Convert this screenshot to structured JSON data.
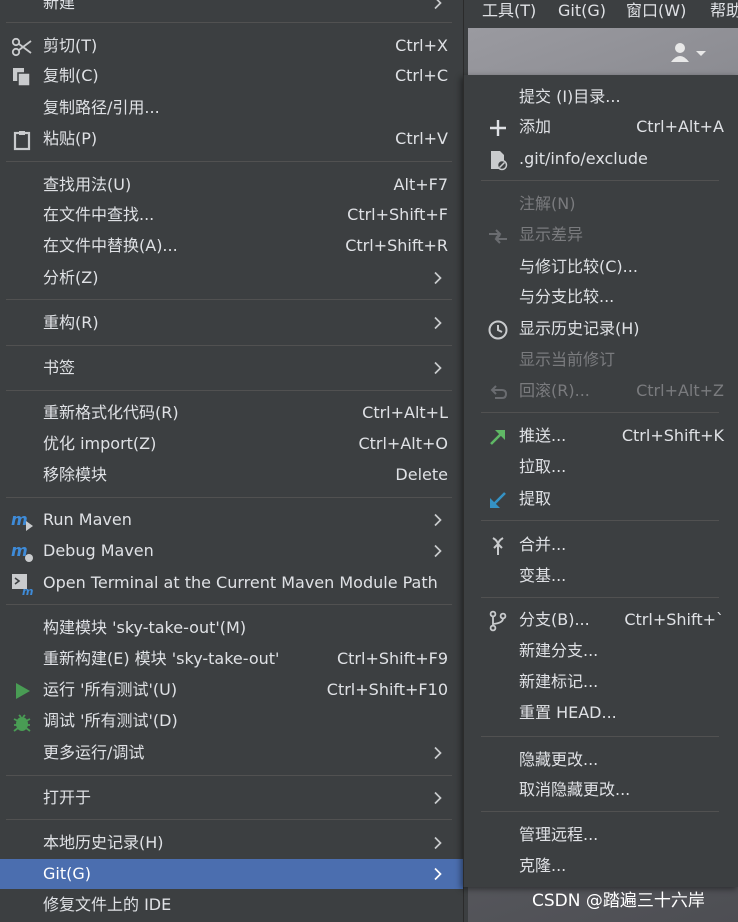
{
  "menubar": {
    "items": [
      "工具(T)",
      "Git(G)",
      "窗口(W)",
      "帮助"
    ]
  },
  "context_menu": {
    "items": [
      {
        "label": "新建",
        "shortcut": "",
        "icon": "",
        "submenu": true
      },
      {
        "label": "剪切(T)",
        "shortcut": "Ctrl+X",
        "icon": "scissors-icon",
        "submenu": false
      },
      {
        "label": "复制(C)",
        "shortcut": "Ctrl+C",
        "icon": "copy-icon",
        "submenu": false
      },
      {
        "label": "复制路径/引用...",
        "shortcut": "",
        "icon": "",
        "submenu": false
      },
      {
        "label": "粘贴(P)",
        "shortcut": "Ctrl+V",
        "icon": "paste-icon",
        "submenu": false
      },
      {
        "label": "查找用法(U)",
        "shortcut": "Alt+F7",
        "icon": "",
        "submenu": false
      },
      {
        "label": "在文件中查找...",
        "shortcut": "Ctrl+Shift+F",
        "icon": "",
        "submenu": false
      },
      {
        "label": "在文件中替换(A)...",
        "shortcut": "Ctrl+Shift+R",
        "icon": "",
        "submenu": false
      },
      {
        "label": "分析(Z)",
        "shortcut": "",
        "icon": "",
        "submenu": true
      },
      {
        "label": "重构(R)",
        "shortcut": "",
        "icon": "",
        "submenu": true
      },
      {
        "label": "书签",
        "shortcut": "",
        "icon": "",
        "submenu": true
      },
      {
        "label": "重新格式化代码(R)",
        "shortcut": "Ctrl+Alt+L",
        "icon": "",
        "submenu": false
      },
      {
        "label": "优化 import(Z)",
        "shortcut": "Ctrl+Alt+O",
        "icon": "",
        "submenu": false
      },
      {
        "label": "移除模块",
        "shortcut": "Delete",
        "icon": "",
        "submenu": false
      },
      {
        "label": "Run Maven",
        "shortcut": "",
        "icon": "maven-run-icon",
        "submenu": true
      },
      {
        "label": "Debug Maven",
        "shortcut": "",
        "icon": "maven-debug-icon",
        "submenu": true
      },
      {
        "label": "Open Terminal at the Current Maven Module Path",
        "shortcut": "",
        "icon": "maven-terminal-icon",
        "submenu": false
      },
      {
        "label": "构建模块 'sky-take-out'(M)",
        "shortcut": "",
        "icon": "",
        "submenu": false
      },
      {
        "label": "重新构建(E) 模块 'sky-take-out'",
        "shortcut": "Ctrl+Shift+F9",
        "icon": "",
        "submenu": false
      },
      {
        "label": "运行 '所有测试'(U)",
        "shortcut": "Ctrl+Shift+F10",
        "icon": "run-icon",
        "submenu": false
      },
      {
        "label": "调试 '所有测试'(D)",
        "shortcut": "",
        "icon": "debug-bug-icon",
        "submenu": false
      },
      {
        "label": "更多运行/调试",
        "shortcut": "",
        "icon": "",
        "submenu": true
      },
      {
        "label": "打开于",
        "shortcut": "",
        "icon": "",
        "submenu": true
      },
      {
        "label": "本地历史记录(H)",
        "shortcut": "",
        "icon": "",
        "submenu": true
      },
      {
        "label": "Git(G)",
        "shortcut": "",
        "icon": "",
        "submenu": true
      },
      {
        "label": "修复文件上的 IDE",
        "shortcut": "",
        "icon": "",
        "submenu": false
      }
    ]
  },
  "git_submenu": {
    "items": [
      {
        "label": "提交 (I)目录...",
        "shortcut": "",
        "icon": "",
        "disabled": false
      },
      {
        "label": "添加",
        "shortcut": "Ctrl+Alt+A",
        "icon": "plus-icon",
        "disabled": false
      },
      {
        "label": ".git/info/exclude",
        "shortcut": "",
        "icon": "git-ignore-file-icon",
        "disabled": false
      },
      {
        "label": "注解(N)",
        "shortcut": "",
        "icon": "",
        "disabled": true
      },
      {
        "label": "显示差异",
        "shortcut": "",
        "icon": "diff-arrows-icon",
        "disabled": true
      },
      {
        "label": "与修订比较(C)...",
        "shortcut": "",
        "icon": "",
        "disabled": false
      },
      {
        "label": "与分支比较...",
        "shortcut": "",
        "icon": "",
        "disabled": false
      },
      {
        "label": "显示历史记录(H)",
        "shortcut": "",
        "icon": "history-clock-icon",
        "disabled": false
      },
      {
        "label": "显示当前修订",
        "shortcut": "",
        "icon": "",
        "disabled": true
      },
      {
        "label": "回滚(R)...",
        "shortcut": "Ctrl+Alt+Z",
        "icon": "rollback-icon",
        "disabled": true
      },
      {
        "label": "推送...",
        "shortcut": "Ctrl+Shift+K",
        "icon": "push-arrow-icon",
        "disabled": false
      },
      {
        "label": "拉取...",
        "shortcut": "",
        "icon": "",
        "disabled": false
      },
      {
        "label": "提取",
        "shortcut": "",
        "icon": "fetch-arrow-icon",
        "disabled": false
      },
      {
        "label": "合并...",
        "shortcut": "",
        "icon": "merge-icon",
        "disabled": false
      },
      {
        "label": "变基...",
        "shortcut": "",
        "icon": "",
        "disabled": false
      },
      {
        "label": "分支(B)...",
        "shortcut": "Ctrl+Shift+`",
        "icon": "branch-icon",
        "disabled": false
      },
      {
        "label": "新建分支...",
        "shortcut": "",
        "icon": "",
        "disabled": false
      },
      {
        "label": "新建标记...",
        "shortcut": "",
        "icon": "",
        "disabled": false
      },
      {
        "label": "重置 HEAD...",
        "shortcut": "",
        "icon": "",
        "disabled": false
      },
      {
        "label": "隐藏更改...",
        "shortcut": "",
        "icon": "",
        "disabled": false
      },
      {
        "label": "取消隐藏更改...",
        "shortcut": "",
        "icon": "",
        "disabled": false
      },
      {
        "label": "管理远程...",
        "shortcut": "",
        "icon": "",
        "disabled": false
      },
      {
        "label": "克隆...",
        "shortcut": "",
        "icon": "",
        "disabled": false
      }
    ]
  },
  "watermark": "CSDN @踏遍三十六岸",
  "colors": {
    "background": "#3c3f41",
    "selection": "#4b6eaf",
    "text": "#dfe1e5",
    "disabled_text": "#7a7b7e",
    "separator": "#515151",
    "run_green": "#499c54",
    "push_green": "#5fb865",
    "fetch_blue": "#3592c4",
    "maven_blue": "#3e8bd8"
  }
}
